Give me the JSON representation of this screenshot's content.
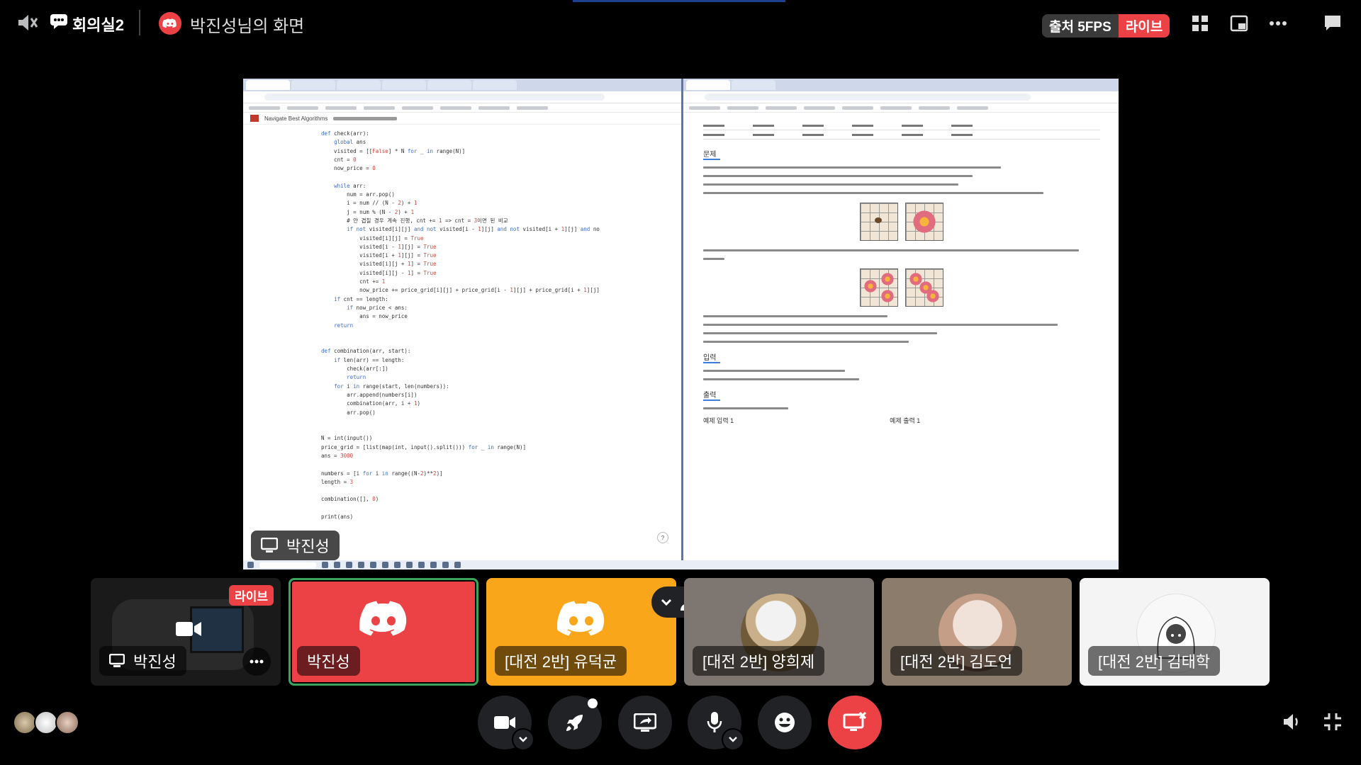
{
  "header": {
    "channel_title": "회의실2",
    "stream_title": "박진성님의 화면",
    "fps_badge": "출처 5FPS",
    "live_badge": "라이브"
  },
  "shared_screen": {
    "label": "박진성",
    "left_window": {
      "notion_breadcrumb": "Navigate Best Algorithms",
      "code": [
        "def check(arr):",
        "    global ans",
        "    visited = [[False] * N for _ in range(N)]",
        "    cnt = 0",
        "    now_price = 0",
        "",
        "    while arr:",
        "        num = arr.pop()",
        "        i = num // (N - 2) + 1",
        "        j = num % (N - 2) + 1",
        "        # 안 겹칠 경우 계속 진행, cnt += 1 => cnt = 3이면 된 비교",
        "        if not visited[i][j] and not visited[i - 1][j] and not visited[i + 1][j] and no",
        "            visited[i][j] = True",
        "            visited[i - 1][j] = True",
        "            visited[i + 1][j] = True",
        "            visited[i][j + 1] = True",
        "            visited[i][j - 1] = True",
        "            cnt += 1",
        "            now_price += price_grid[i][j] + price_grid[i - 1][j] + price_grid[i + 1][j]",
        "    if cnt == length:",
        "        if now_price < ans:",
        "            ans = now_price",
        "    return",
        "",
        "",
        "def combination(arr, start):",
        "    if len(arr) == length:",
        "        check(arr[:])",
        "        return",
        "    for i in range(start, len(numbers)):",
        "        arr.append(numbers[i])",
        "        combination(arr, i + 1)",
        "        arr.pop()",
        "",
        "",
        "N = int(input())",
        "price_grid = [list(map(int, input().split())) for _ in range(N)]",
        "ans = 3000",
        "",
        "numbers = [i for i in range((N-2)**2)]",
        "length = 3",
        "",
        "combination([], 0)",
        "",
        "print(ans)"
      ]
    },
    "right_window": {
      "section_problem": "문제",
      "section_input": "입력",
      "section_output": "출력",
      "example_input": "예제 입력 1",
      "example_output": "예제 출력 1"
    }
  },
  "participants": [
    {
      "name": "박진성",
      "type": "stream",
      "badge": "라이브"
    },
    {
      "name": "박진성",
      "type": "discord",
      "color": "#ed4245"
    },
    {
      "name": "[대전 2반] 유덕균",
      "type": "discord",
      "color": "#faa61a"
    },
    {
      "name": "[대전 2반] 양희제",
      "type": "photo"
    },
    {
      "name": "[대전 2반] 김도언",
      "type": "photo"
    },
    {
      "name": "[대전 2반] 김태학",
      "type": "photo"
    }
  ],
  "colors": {
    "accent_red": "#ed4245",
    "accent_orange": "#faa61a",
    "speaking_green": "#3ba55d"
  },
  "icons": [
    "speaker-muted-icon",
    "chat-bubble-icon",
    "discord-icon",
    "grid-layout-icon",
    "popout-icon",
    "more-icon",
    "chat-icon",
    "camera-icon",
    "rocket-icon",
    "screen-share-icon",
    "microphone-icon",
    "emoji-icon",
    "disconnect-icon",
    "volume-icon",
    "fullscreen-exit-icon",
    "people-icon"
  ]
}
